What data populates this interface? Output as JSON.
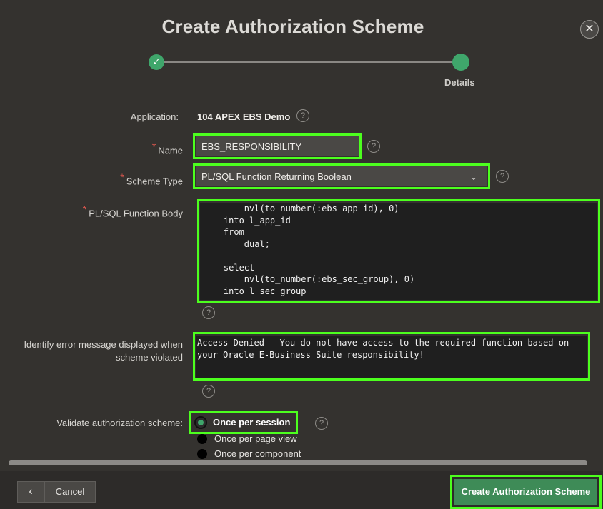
{
  "dialog": {
    "title": "Create Authorization Scheme",
    "close_icon": "close-icon"
  },
  "wizard": {
    "steps": [
      {
        "label": "",
        "state": "done"
      },
      {
        "label": "Details",
        "state": "current"
      }
    ]
  },
  "form": {
    "application": {
      "label": "Application:",
      "value": "104 APEX EBS Demo"
    },
    "name": {
      "label": "Name",
      "value": "EBS_RESPONSIBILITY"
    },
    "scheme_type": {
      "label": "Scheme Type",
      "value": "PL/SQL Function Returning Boolean"
    },
    "function_body": {
      "label": "PL/SQL Function Body",
      "code": "        nvl(to_number(:ebs_app_id), 0)\n    into l_app_id\n    from\n        dual;\n\n    select\n        nvl(to_number(:ebs_sec_group), 0)\n    into l_sec_group"
    },
    "error_message": {
      "label_line1": "Identify error message displayed when",
      "label_line2": "scheme violated",
      "value": "Access Denied - You do not have access to the required function based on\nyour Oracle E-Business Suite responsibility!"
    },
    "validate": {
      "label": "Validate authorization scheme:",
      "options": [
        "Once per session",
        "Once per page view",
        "Once per component"
      ],
      "selected": "Once per session"
    }
  },
  "footer": {
    "cancel_label": "Cancel",
    "create_label": "Create Authorization Scheme"
  },
  "colors": {
    "highlight": "#4cff1e",
    "accent_green": "#3fa66b",
    "background": "#34322f"
  }
}
